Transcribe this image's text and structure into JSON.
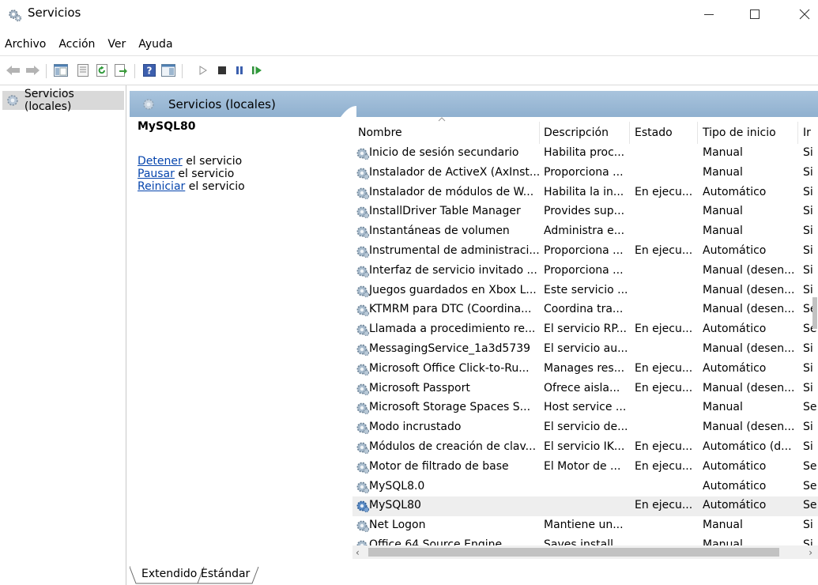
{
  "window": {
    "title": "Servicios",
    "icon": "services-gear-icon",
    "controls": [
      "minimize-icon",
      "maximize-icon",
      "close-icon"
    ]
  },
  "menu": [
    "Archivo",
    "Acción",
    "Ver",
    "Ayuda"
  ],
  "toolbar": {
    "buttons": [
      "back-arrow-icon",
      "forward-arrow-icon",
      "console-tree-icon",
      "properties-icon",
      "refresh-icon",
      "export-list-icon",
      "help-icon",
      "show-hide-action-pane-icon",
      "start-service-icon",
      "stop-service-icon",
      "pause-service-icon",
      "restart-service-icon"
    ]
  },
  "tree": {
    "item": "Servicios (locales)"
  },
  "pane": {
    "header": "Servicios (locales)",
    "detail": {
      "service_name": "MySQL80",
      "actions": [
        {
          "link": "Detener",
          "rest": " el servicio"
        },
        {
          "link": "Pausar",
          "rest": " el servicio"
        },
        {
          "link": "Reiniciar",
          "rest": " el servicio"
        }
      ]
    }
  },
  "list": {
    "columns": [
      "Nombre",
      "Descripción",
      "Estado",
      "Tipo de inicio",
      "Ir"
    ],
    "rows": [
      {
        "name": "Inicio de sesión secundario",
        "desc": "Habilita proc...",
        "state": "",
        "type": "Manual",
        "ini": "Si"
      },
      {
        "name": "Instalador de ActiveX (AxInst...",
        "desc": "Proporciona ...",
        "state": "",
        "type": "Manual",
        "ini": "Si"
      },
      {
        "name": "Instalador de módulos de W...",
        "desc": "Habilita la in...",
        "state": "En ejecu...",
        "type": "Automático",
        "ini": "Si"
      },
      {
        "name": "InstallDriver Table Manager",
        "desc": "Provides sup...",
        "state": "",
        "type": "Manual",
        "ini": "Si"
      },
      {
        "name": "Instantáneas de volumen",
        "desc": "Administra e...",
        "state": "",
        "type": "Manual",
        "ini": "Si"
      },
      {
        "name": "Instrumental de administraci...",
        "desc": "Proporciona ...",
        "state": "En ejecu...",
        "type": "Automático",
        "ini": "Si"
      },
      {
        "name": "Interfaz de servicio invitado ...",
        "desc": "Proporciona ...",
        "state": "",
        "type": "Manual (desen...",
        "ini": "Si"
      },
      {
        "name": "Juegos guardados en Xbox L...",
        "desc": "Este servicio ...",
        "state": "",
        "type": "Manual (desen...",
        "ini": "Si"
      },
      {
        "name": "KTMRM para DTC (Coordina...",
        "desc": "Coordina tra...",
        "state": "",
        "type": "Manual (desen...",
        "ini": "Se"
      },
      {
        "name": "Llamada a procedimiento re...",
        "desc": "El servicio RP...",
        "state": "En ejecu...",
        "type": "Automático",
        "ini": "Se"
      },
      {
        "name": "MessagingService_1a3d5739",
        "desc": "El servicio au...",
        "state": "",
        "type": "Manual (desen...",
        "ini": "Si"
      },
      {
        "name": "Microsoft Office Click-to-Ru...",
        "desc": "Manages res...",
        "state": "En ejecu...",
        "type": "Automático",
        "ini": "Si"
      },
      {
        "name": "Microsoft Passport",
        "desc": "Ofrece aisla...",
        "state": "En ejecu...",
        "type": "Manual (desen...",
        "ini": "Si"
      },
      {
        "name": "Microsoft Storage Spaces S...",
        "desc": "Host service ...",
        "state": "",
        "type": "Manual",
        "ini": "Se"
      },
      {
        "name": "Modo incrustado",
        "desc": "El servicio de...",
        "state": "",
        "type": "Manual (desen...",
        "ini": "Si"
      },
      {
        "name": "Módulos de creación de clav...",
        "desc": "El servicio IK...",
        "state": "En ejecu...",
        "type": "Automático (d...",
        "ini": "Si"
      },
      {
        "name": "Motor de filtrado de base",
        "desc": "El Motor de ...",
        "state": "En ejecu...",
        "type": "Automático",
        "ini": "Se"
      },
      {
        "name": "MySQL8.0",
        "desc": "",
        "state": "",
        "type": "Automático",
        "ini": "Se"
      },
      {
        "name": "MySQL80",
        "desc": "",
        "state": "En ejecu...",
        "type": "Automático",
        "ini": "Se",
        "selected": true
      },
      {
        "name": "Net Logon",
        "desc": "Mantiene un...",
        "state": "",
        "type": "Manual",
        "ini": "Si"
      },
      {
        "name": "Office 64 Source Engine",
        "desc": "Saves install...",
        "state": "",
        "type": "Manual",
        "ini": "Si"
      }
    ]
  },
  "tabs": [
    "Extendido",
    "Estándar"
  ]
}
